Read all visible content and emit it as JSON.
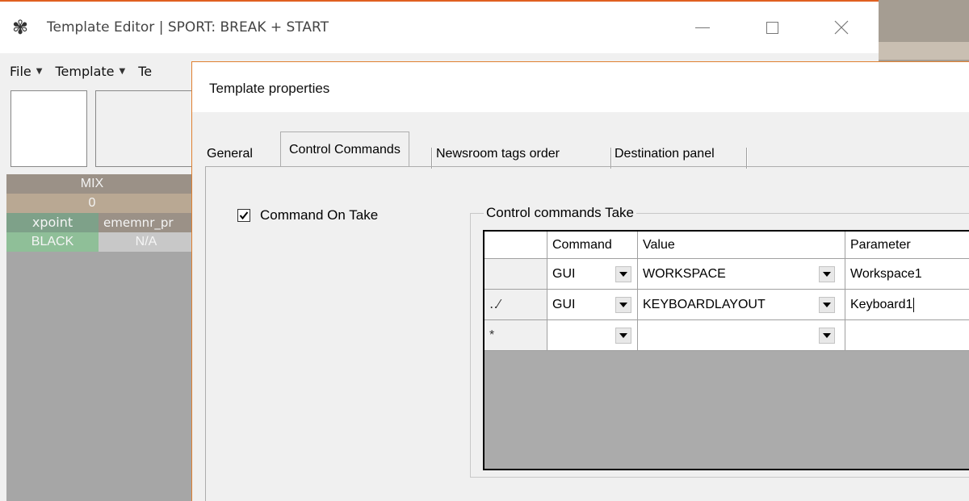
{
  "editor": {
    "title": "Template Editor | SPORT: BREAK + START",
    "menu": [
      {
        "label": "File"
      },
      {
        "label": "Template"
      },
      {
        "label": "Te"
      }
    ],
    "panel": {
      "mix": "MIX",
      "value": "0",
      "xpoint": "xpoint",
      "ememnr": "ememnr_pr",
      "source": "BLACK",
      "na": "N/A"
    }
  },
  "dialog": {
    "title": "Template properties",
    "tabs": [
      {
        "label": "General"
      },
      {
        "label": "Control Commands"
      },
      {
        "label": "Newsroom tags order"
      },
      {
        "label": "Destination panel"
      }
    ],
    "active_tab": "Control Commands",
    "command_on_take": {
      "label": "Command On Take",
      "checked": true
    },
    "group_label": "Control commands Take",
    "grid": {
      "columns": [
        "Command",
        "Value",
        "Parameter"
      ],
      "rows": [
        {
          "marker": "",
          "command": "GUI",
          "value": "WORKSPACE",
          "parameter": "Workspace1"
        },
        {
          "marker": "⁄",
          "command": "GUI",
          "value": "KEYBOARDLAYOUT",
          "parameter": "Keyboard1"
        },
        {
          "marker": "*",
          "command": "",
          "value": "",
          "parameter": ""
        }
      ]
    }
  },
  "colors": {
    "accent_border": "#e06020",
    "grid_background": "#ababab",
    "xpoint_green": "#7ea189",
    "black_green": "#8fbf98"
  }
}
